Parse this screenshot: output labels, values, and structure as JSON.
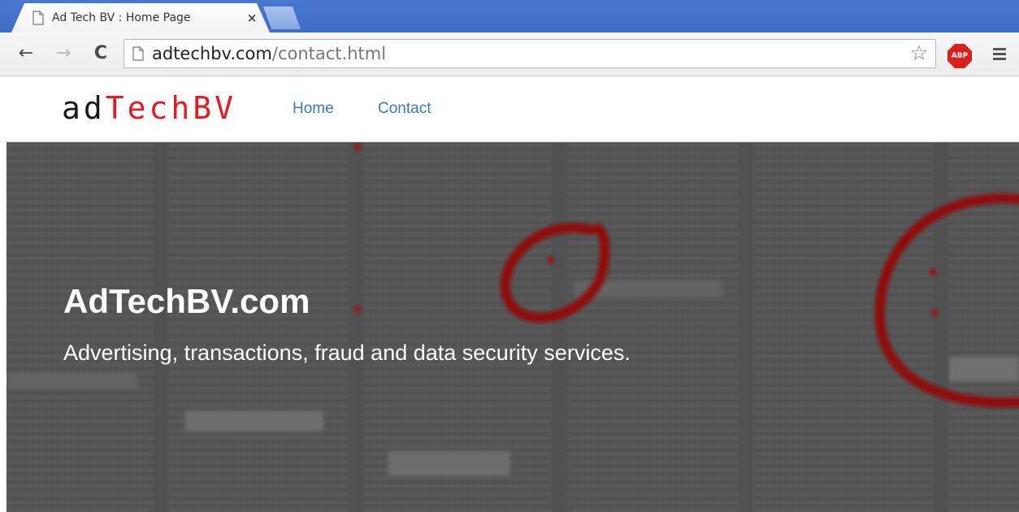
{
  "browser": {
    "tab": {
      "title": "Ad Tech BV : Home Page",
      "close_glyph": "×"
    },
    "toolbar": {
      "back_glyph": "←",
      "forward_glyph": "→",
      "reload_glyph": "C",
      "url_host": "adtechbv.com",
      "url_path": "/contact.html",
      "star_glyph": "☆",
      "extension_label": "ABP"
    },
    "icons": [
      "page-icon",
      "close-icon",
      "back-icon",
      "forward-icon",
      "reload-icon",
      "star-icon",
      "adblock-icon",
      "menu-icon"
    ]
  },
  "site": {
    "logo": {
      "part1": "ad",
      "part2": "TechBV"
    },
    "nav": [
      {
        "label": "Home"
      },
      {
        "label": "Contact"
      }
    ],
    "hero": {
      "title": "AdTechBV.com",
      "subtitle": "Advertising, transactions, fraud and data security services."
    }
  },
  "colors": {
    "tabstrip": "#4170c9",
    "logo_red": "#e31b23",
    "nav_link": "#3e79b6",
    "hero_overlay": "#4b4b4b",
    "marker_red": "#8e0b0b"
  }
}
